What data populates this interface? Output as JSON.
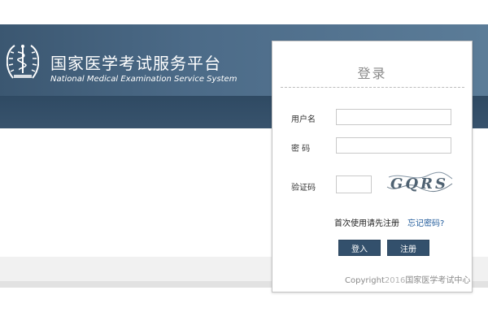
{
  "header": {
    "title_cn": "国家医学考试服务平台",
    "title_en": "National Medical Examination Service System"
  },
  "login": {
    "title": "登录",
    "username_label": "用户名",
    "username_value": "",
    "password_label": "密 码",
    "password_value": "",
    "captcha_label": "验证码",
    "captcha_value": "",
    "captcha_text": "GQRS",
    "first_use_text": "首次使用请先注册",
    "forgot_password_link": "忘记密码?",
    "login_button": "登入",
    "register_button": "注册",
    "copyright_prefix": "Copyright",
    "copyright_year": "2016",
    "copyright_org": "国家医学考试中心"
  },
  "colors": {
    "banner": "#4c6b88",
    "band": "#2f4a63",
    "button": "#33506c",
    "link": "#1f5a9a"
  },
  "icons": {
    "logo": "medical-emblem-icon"
  }
}
